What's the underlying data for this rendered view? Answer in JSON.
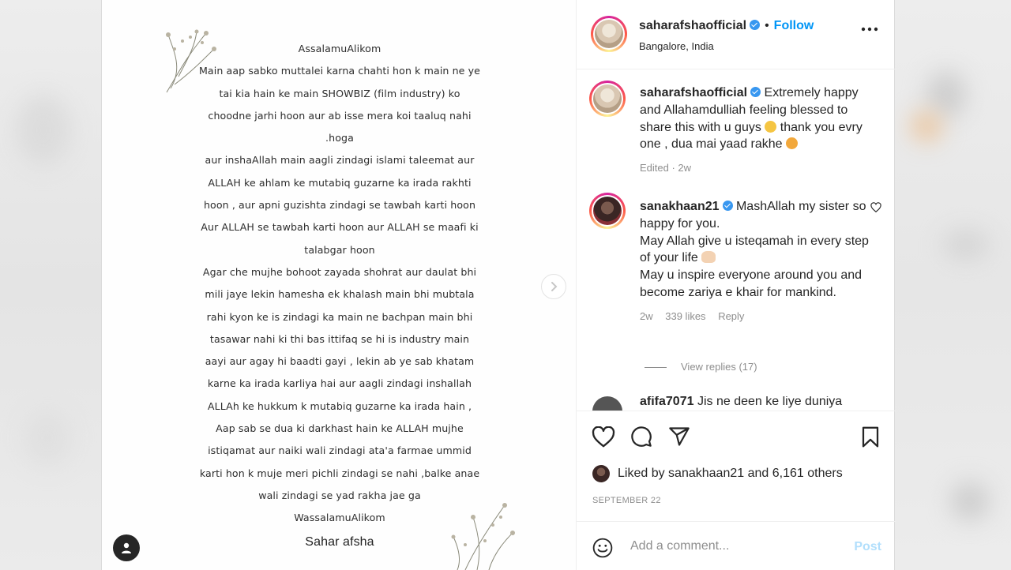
{
  "post_image": {
    "letter_lines": [
      "AssalamuAlikom",
      "Main aap sabko muttalei karna chahti hon k main ne  ye",
      "tai kia hain ke main SHOWBIZ (film industry) ko",
      "choodne jarhi hoon aur ab isse mera koi taaluq  nahi",
      ".hoga",
      "aur inshaAllah main aagli zindagi islami taleemat aur",
      "ALLAH  ke ahlam ke mutabiq guzarne ka irada rakhti",
      "hoon , aur apni guzishta zindagi se tawbah  karti hoon",
      "Aur  ALLAH se tawbah karti hoon aur ALLAH se maafi ki",
      "talabgar hoon",
      "Agar che  mujhe bohoot zayada shohrat aur daulat  bhi",
      "mili jaye lekin  hamesha ek khalash main  bhi mubtala",
      "rahi kyon ke is zindagi ka main ne bachpan main bhi",
      "tasawar nahi ki thi bas ittifaq  se hi is industry  main",
      "aayi aur agay hi baadti  gayi , lekin ab ye sab khatam",
      "karne ka irada karliya hai aur aagli zindagi inshallah",
      "ALLAh  ke hukkum k mutabiq guzarne ka irada hain ,",
      "Aap  sab se dua ki darkhast hain ke ALLAH mujhe",
      "istiqamat aur naiki wali zindagi ata'a farmae ummid",
      "karti hon k muje meri pichli zindagi se nahi ,balke anae",
      "wali zindagi se yad rakha jae ga",
      "WassalamuAlikom"
    ],
    "signature": "Sahar afsha"
  },
  "header": {
    "username": "saharafshaofficial",
    "separator": "•",
    "follow_label": "Follow",
    "location": "Bangalore, India"
  },
  "caption": {
    "username": "saharafshaofficial",
    "text_part1": "Extremely happy and Allahamdulliah feeling blessed to share this with u guys",
    "text_part2": "thank you evry one , dua mai yaad rakhe",
    "meta": "Edited · 2w"
  },
  "comment1": {
    "username": "sanakhaan21",
    "line1": "MashAllah my sister so happy for you.",
    "line2": "May Allah give u isteqamah in every step of your life",
    "line3": "May u inspire everyone around you and become zariya e khair for mankind.",
    "time": "2w",
    "likes": "339 likes",
    "reply": "Reply"
  },
  "view_replies": "View replies (17)",
  "comment2_partial": {
    "username": "afifa7071",
    "text": "Jis ne deen ke liye duniya"
  },
  "actions": {
    "liked_by_prefix": "Liked by",
    "liked_by_user": "sanakhaan21",
    "liked_by_and": "and",
    "liked_by_others": "6,161 others",
    "date": "SEPTEMBER 22"
  },
  "add_comment": {
    "placeholder": "Add a comment...",
    "post_label": "Post"
  },
  "colors": {
    "link_blue": "#0095f6",
    "post_disabled": "#b2dffc",
    "muted": "#8e8e8e",
    "verified": "#3897f0"
  },
  "icons": [
    "more-options-icon",
    "verified-icon",
    "heart-icon",
    "comment-icon",
    "share-icon",
    "bookmark-icon",
    "emoji-icon",
    "chevron-right-icon",
    "user-tag-icon"
  ]
}
